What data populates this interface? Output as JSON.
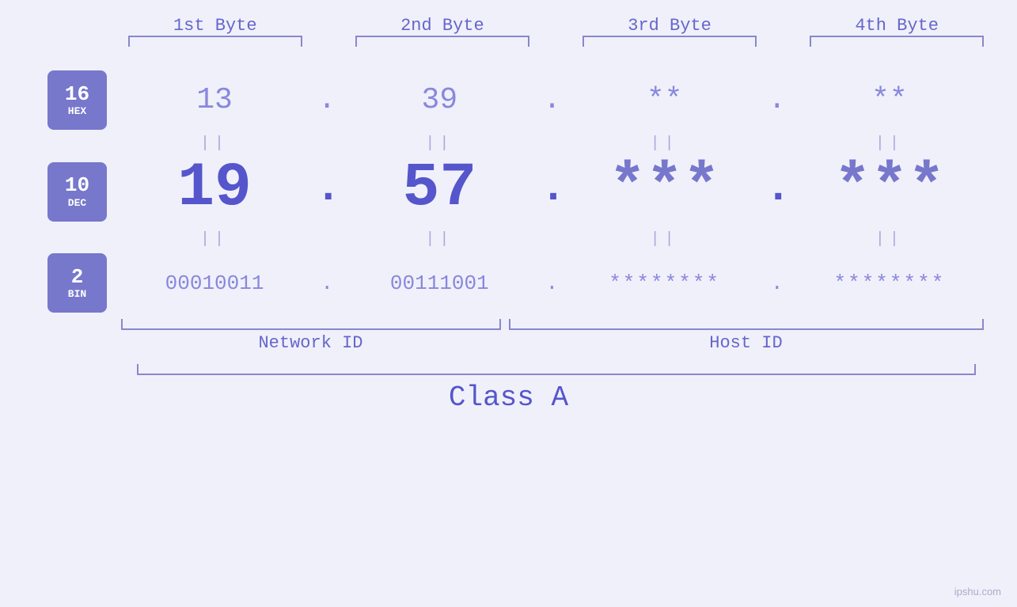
{
  "headers": {
    "col1": "1st Byte",
    "col2": "2nd Byte",
    "col3": "3rd Byte",
    "col4": "4th Byte"
  },
  "badges": {
    "hex": {
      "num": "16",
      "label": "HEX"
    },
    "dec": {
      "num": "10",
      "label": "DEC"
    },
    "bin": {
      "num": "2",
      "label": "BIN"
    }
  },
  "hex_row": {
    "b1": "13",
    "b2": "39",
    "b3": "**",
    "b4": "**",
    "dot": "."
  },
  "dec_row": {
    "b1": "19",
    "b2": "57",
    "b3": "***",
    "b4": "***",
    "dot": "."
  },
  "bin_row": {
    "b1": "00010011",
    "b2": "00111001",
    "b3": "********",
    "b4": "********",
    "dot": "."
  },
  "labels": {
    "network_id": "Network ID",
    "host_id": "Host ID",
    "class": "Class A"
  },
  "watermark": "ipshu.com"
}
